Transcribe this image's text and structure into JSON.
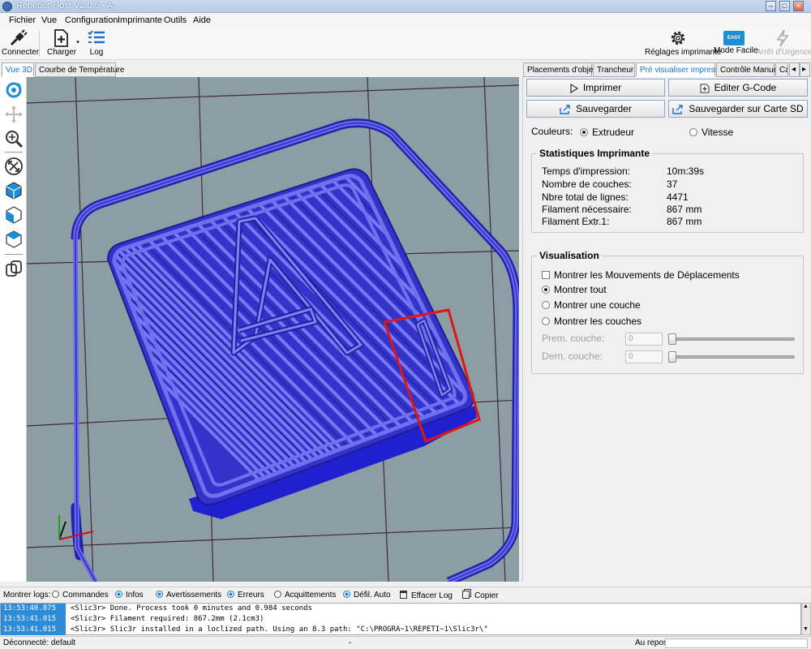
{
  "window": {
    "title": "Repetier-Host V2.0.5 - A"
  },
  "menu": [
    "Fichier",
    "Vue",
    "Configuration",
    "Imprimante",
    "Outils",
    "Aide"
  ],
  "toolbar": {
    "connect": "Connecter",
    "load": "Charger",
    "log": "Log",
    "printer_settings": "Réglages imprimante",
    "easy_mode": "Mode Facile",
    "easy_badge": "EASY",
    "emergency": "Arrêt d'Urgence"
  },
  "left_tabs": [
    "Vue 3D",
    "Courbe de Température"
  ],
  "right_tabs": [
    "Placements d'objets",
    "Trancheur",
    "Pré visualiser impression",
    "Contrôle Manuel",
    "Ca"
  ],
  "panel": {
    "print_btn": "Imprimer",
    "edit_gcode_btn": "Editer G-Code",
    "save_btn": "Sauvegarder",
    "save_sd_btn": "Sauvegarder sur Carte SD",
    "colors_label": "Couleurs:",
    "color_extruder": "Extrudeur",
    "color_speed": "Vitesse",
    "stats_title": "Statistiques Imprimante",
    "stats": [
      {
        "label": "Temps d'impression:",
        "value": "10m:39s"
      },
      {
        "label": "Nombre de couches:",
        "value": "37"
      },
      {
        "label": "Nbre total de lignes:",
        "value": "4471"
      },
      {
        "label": "Filament nécessaire:",
        "value": "867 mm"
      },
      {
        "label": "Filament Extr.1:",
        "value": "867 mm"
      }
    ],
    "vis_title": "Visualisation",
    "show_moves": "Montrer les Mouvements de Déplacements",
    "show_all": "Montrer tout",
    "show_one": "Montrer une couche",
    "show_layers": "Montrer les couches",
    "first_layer_label": "Prem. couche:",
    "last_layer_label": "Dern. couche:",
    "first_layer_value": "0",
    "last_layer_value": "0"
  },
  "logbar": {
    "show_logs": "Montrer logs:",
    "commands": "Commandes",
    "infos": "Infos",
    "warnings": "Avertissements",
    "errors": "Erreurs",
    "acks": "Acquittements",
    "autoscroll": "Défil. Auto",
    "clear": "Effacer Log",
    "copy": "Copier"
  },
  "log": [
    {
      "time": "13:53:40.875",
      "msg": "<Slic3r> Done. Process took 0 minutes and 0.984 seconds"
    },
    {
      "time": "13:53:41.015",
      "msg": "<Slic3r> Filament required: 867.2mm (2.1cm3)"
    },
    {
      "time": "13:53:41.015",
      "msg": "<Slic3r> Slic3r installed in a loclized path. Using an 8.3 path: \"C:\\PROGRA~1\\REPETI~1\\Slic3r\\\""
    }
  ],
  "status": {
    "connection": "Déconnecté: default",
    "middle": "-",
    "state": "Au repos"
  },
  "colors": {
    "model": "#3333cc",
    "model_light": "#6a6af0",
    "bed": "#8c9da4",
    "highlight": "#e01515",
    "accent": "#1a6fcc"
  }
}
